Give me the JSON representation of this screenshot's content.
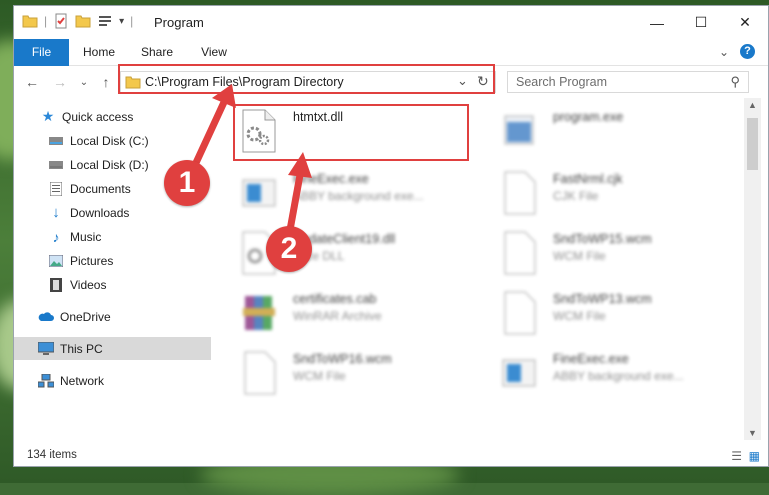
{
  "window": {
    "title": "Program",
    "minimize_glyph": "—",
    "maximize_glyph": "☐",
    "close_glyph": "✕"
  },
  "ribbon": {
    "tabs": [
      {
        "label": "File"
      },
      {
        "label": "Home"
      },
      {
        "label": "Share"
      },
      {
        "label": "View"
      }
    ],
    "collapse_glyph": "⌄",
    "help_glyph": "?"
  },
  "navbar": {
    "back_glyph": "←",
    "forward_glyph": "→",
    "recent_glyph": "⌄",
    "up_glyph": "↑",
    "address": "C:\\Program Files\\Program Directory",
    "address_dropdown_glyph": "⌄",
    "refresh_glyph": "↻",
    "search_placeholder": "Search Program",
    "search_glyph": "⚲"
  },
  "sidebar": {
    "items": [
      {
        "label": "Quick access",
        "icon": "star-icon"
      },
      {
        "label": "Local Disk (C:)",
        "icon": "drive-icon"
      },
      {
        "label": "Local Disk (D:)",
        "icon": "drive-icon"
      },
      {
        "label": "Documents",
        "icon": "documents-icon"
      },
      {
        "label": "Downloads",
        "icon": "download-icon"
      },
      {
        "label": "Music",
        "icon": "music-icon"
      },
      {
        "label": "Pictures",
        "icon": "pictures-icon"
      },
      {
        "label": "Videos",
        "icon": "videos-icon"
      },
      {
        "label": "OneDrive",
        "icon": "cloud-icon"
      },
      {
        "label": "This PC",
        "icon": "computer-icon"
      },
      {
        "label": "Network",
        "icon": "network-icon"
      }
    ]
  },
  "files": [
    {
      "name": "htmtxt.dll",
      "type": ""
    },
    {
      "name": "program.exe",
      "type": ""
    },
    {
      "name": "FineExec.exe",
      "type": "ABBY background exe..."
    },
    {
      "name": "FastNrml.cjk",
      "type": "CJK File"
    },
    {
      "name": "UpdateClient19.dll",
      "type": "ence DLL"
    },
    {
      "name": "SndToWP15.wcm",
      "type": "WCM File"
    },
    {
      "name": "certificates.cab",
      "type": "WinRAR Archive"
    },
    {
      "name": "SndToWP13.wcm",
      "type": "WCM File"
    },
    {
      "name": "SndToWP16.wcm",
      "type": "WCM File"
    },
    {
      "name": "FineExec.exe",
      "type": "ABBY background exe..."
    }
  ],
  "status": {
    "count": "134 items"
  },
  "annotations": {
    "step1": "1",
    "step2": "2"
  },
  "colors": {
    "accent": "#1979ca",
    "annotation_red": "#e0403f",
    "folder_yellow": "#f3c84c"
  }
}
